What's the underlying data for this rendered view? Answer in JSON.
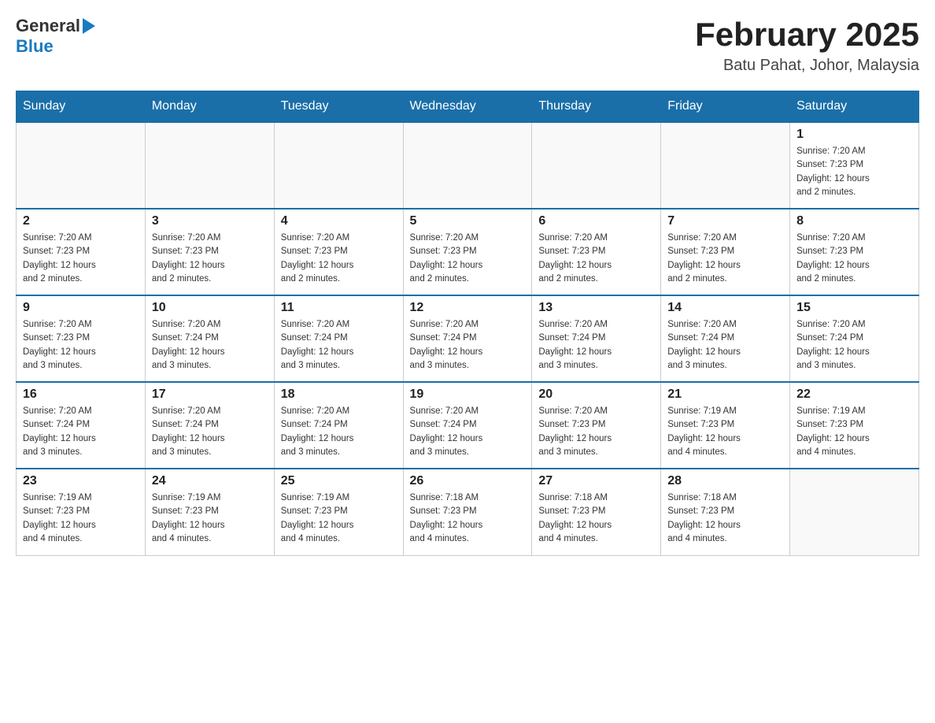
{
  "header": {
    "logo_general": "General",
    "logo_blue": "Blue",
    "month_year": "February 2025",
    "location": "Batu Pahat, Johor, Malaysia"
  },
  "days_of_week": [
    "Sunday",
    "Monday",
    "Tuesday",
    "Wednesday",
    "Thursday",
    "Friday",
    "Saturday"
  ],
  "weeks": [
    [
      {
        "day": "",
        "info": ""
      },
      {
        "day": "",
        "info": ""
      },
      {
        "day": "",
        "info": ""
      },
      {
        "day": "",
        "info": ""
      },
      {
        "day": "",
        "info": ""
      },
      {
        "day": "",
        "info": ""
      },
      {
        "day": "1",
        "info": "Sunrise: 7:20 AM\nSunset: 7:23 PM\nDaylight: 12 hours\nand 2 minutes."
      }
    ],
    [
      {
        "day": "2",
        "info": "Sunrise: 7:20 AM\nSunset: 7:23 PM\nDaylight: 12 hours\nand 2 minutes."
      },
      {
        "day": "3",
        "info": "Sunrise: 7:20 AM\nSunset: 7:23 PM\nDaylight: 12 hours\nand 2 minutes."
      },
      {
        "day": "4",
        "info": "Sunrise: 7:20 AM\nSunset: 7:23 PM\nDaylight: 12 hours\nand 2 minutes."
      },
      {
        "day": "5",
        "info": "Sunrise: 7:20 AM\nSunset: 7:23 PM\nDaylight: 12 hours\nand 2 minutes."
      },
      {
        "day": "6",
        "info": "Sunrise: 7:20 AM\nSunset: 7:23 PM\nDaylight: 12 hours\nand 2 minutes."
      },
      {
        "day": "7",
        "info": "Sunrise: 7:20 AM\nSunset: 7:23 PM\nDaylight: 12 hours\nand 2 minutes."
      },
      {
        "day": "8",
        "info": "Sunrise: 7:20 AM\nSunset: 7:23 PM\nDaylight: 12 hours\nand 2 minutes."
      }
    ],
    [
      {
        "day": "9",
        "info": "Sunrise: 7:20 AM\nSunset: 7:23 PM\nDaylight: 12 hours\nand 3 minutes."
      },
      {
        "day": "10",
        "info": "Sunrise: 7:20 AM\nSunset: 7:24 PM\nDaylight: 12 hours\nand 3 minutes."
      },
      {
        "day": "11",
        "info": "Sunrise: 7:20 AM\nSunset: 7:24 PM\nDaylight: 12 hours\nand 3 minutes."
      },
      {
        "day": "12",
        "info": "Sunrise: 7:20 AM\nSunset: 7:24 PM\nDaylight: 12 hours\nand 3 minutes."
      },
      {
        "day": "13",
        "info": "Sunrise: 7:20 AM\nSunset: 7:24 PM\nDaylight: 12 hours\nand 3 minutes."
      },
      {
        "day": "14",
        "info": "Sunrise: 7:20 AM\nSunset: 7:24 PM\nDaylight: 12 hours\nand 3 minutes."
      },
      {
        "day": "15",
        "info": "Sunrise: 7:20 AM\nSunset: 7:24 PM\nDaylight: 12 hours\nand 3 minutes."
      }
    ],
    [
      {
        "day": "16",
        "info": "Sunrise: 7:20 AM\nSunset: 7:24 PM\nDaylight: 12 hours\nand 3 minutes."
      },
      {
        "day": "17",
        "info": "Sunrise: 7:20 AM\nSunset: 7:24 PM\nDaylight: 12 hours\nand 3 minutes."
      },
      {
        "day": "18",
        "info": "Sunrise: 7:20 AM\nSunset: 7:24 PM\nDaylight: 12 hours\nand 3 minutes."
      },
      {
        "day": "19",
        "info": "Sunrise: 7:20 AM\nSunset: 7:24 PM\nDaylight: 12 hours\nand 3 minutes."
      },
      {
        "day": "20",
        "info": "Sunrise: 7:20 AM\nSunset: 7:23 PM\nDaylight: 12 hours\nand 3 minutes."
      },
      {
        "day": "21",
        "info": "Sunrise: 7:19 AM\nSunset: 7:23 PM\nDaylight: 12 hours\nand 4 minutes."
      },
      {
        "day": "22",
        "info": "Sunrise: 7:19 AM\nSunset: 7:23 PM\nDaylight: 12 hours\nand 4 minutes."
      }
    ],
    [
      {
        "day": "23",
        "info": "Sunrise: 7:19 AM\nSunset: 7:23 PM\nDaylight: 12 hours\nand 4 minutes."
      },
      {
        "day": "24",
        "info": "Sunrise: 7:19 AM\nSunset: 7:23 PM\nDaylight: 12 hours\nand 4 minutes."
      },
      {
        "day": "25",
        "info": "Sunrise: 7:19 AM\nSunset: 7:23 PM\nDaylight: 12 hours\nand 4 minutes."
      },
      {
        "day": "26",
        "info": "Sunrise: 7:18 AM\nSunset: 7:23 PM\nDaylight: 12 hours\nand 4 minutes."
      },
      {
        "day": "27",
        "info": "Sunrise: 7:18 AM\nSunset: 7:23 PM\nDaylight: 12 hours\nand 4 minutes."
      },
      {
        "day": "28",
        "info": "Sunrise: 7:18 AM\nSunset: 7:23 PM\nDaylight: 12 hours\nand 4 minutes."
      },
      {
        "day": "",
        "info": ""
      }
    ]
  ]
}
